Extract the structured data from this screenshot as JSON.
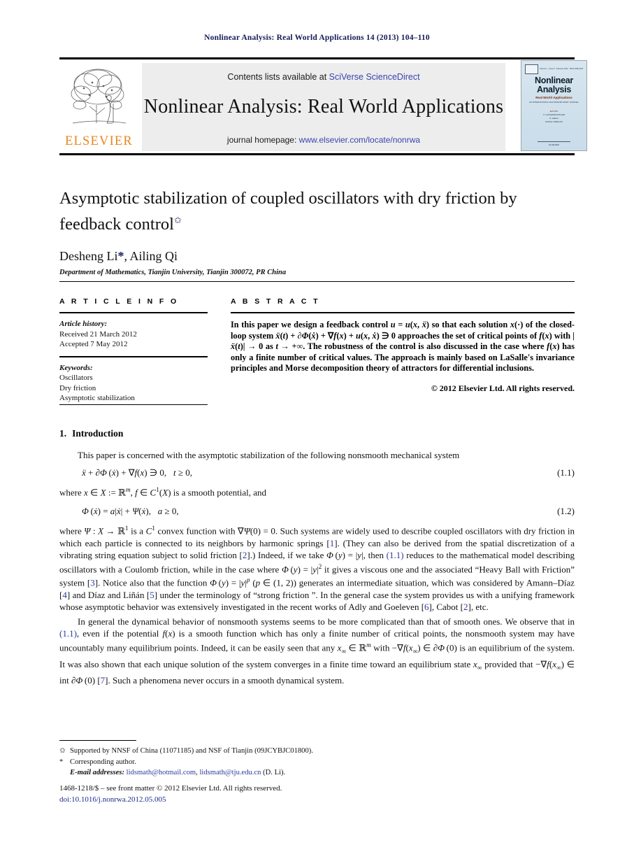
{
  "running_head": "Nonlinear Analysis: Real World Applications 14 (2013) 104–110",
  "masthead": {
    "contents_prefix": "Contents lists available at ",
    "sciencedirect": "SciVerse ScienceDirect",
    "journal_title": "Nonlinear Analysis: Real World Applications",
    "homepage_prefix": "journal homepage: ",
    "homepage_url": "www.elsevier.com/locate/nonrwa",
    "publisher_word": "ELSEVIER",
    "accent_orange": "#e8861e",
    "link_blue": "#3a43b0"
  },
  "cover": {
    "top_left": "Volume 1",
    "top_mid": "Issue 8",
    "top_mid2": "February 2013",
    "top_right": "ISSN 1468-1218",
    "title_line1": "Nonlinear",
    "title_line2": "Analysis",
    "subtitle": "Real World Applications",
    "subtitle2": "AN INTERNATIONAL MULTIDISCIPLINARY JOURNAL",
    "editors_label": "EDITORS",
    "editor1": "V. LAKSHMIKANTHAM",
    "editor2": "S. LEELA",
    "editor3": "DONAL O'REGAN",
    "footer": "ELSEVIER"
  },
  "article": {
    "title": "Asymptotic stabilization of coupled oscillators with dry friction by feedback control",
    "title_footnote_mark": "✩",
    "authors": "Desheng Li",
    "author_corr_mark": "*",
    "authors_rest": ", Ailing Qi",
    "affiliation": "Department of Mathematics, Tianjin University, Tianjin 300072, PR China"
  },
  "info": {
    "heading": "A R T I C L E   I N F O",
    "history_label": "Article history:",
    "received": "Received 21 March 2012",
    "accepted": "Accepted 7 May 2012",
    "keywords_label": "Keywords:",
    "keywords": [
      "Oscillators",
      "Dry friction",
      "Asymptotic stabilization"
    ]
  },
  "abstract": {
    "heading": "A B S T R A C T",
    "copyright": "© 2012 Elsevier Ltd. All rights reserved."
  },
  "sections": {
    "intro_number": "1.",
    "intro_title": "Introduction"
  },
  "equations": {
    "eq11_number": "(1.1)",
    "eq12_number": "(1.2)"
  },
  "footnotes": {
    "star_mark": "✩",
    "star_text": "Supported by NNSF of China (11071185) and NSF of Tianjin (09JCYBJC01800).",
    "corr_mark": "*",
    "corr_text": "Corresponding author.",
    "email_label": "E-mail addresses:",
    "email1": "lidsmath@hotmail.com",
    "email2": "lidsmath@tju.edu.cn",
    "email_suffix": "(D. Li)."
  },
  "colophon": {
    "front_matter": "1468-1218/$ – see front matter © 2012 Elsevier Ltd. All rights reserved.",
    "doi": "doi:10.1016/j.nonrwa.2012.05.005"
  }
}
